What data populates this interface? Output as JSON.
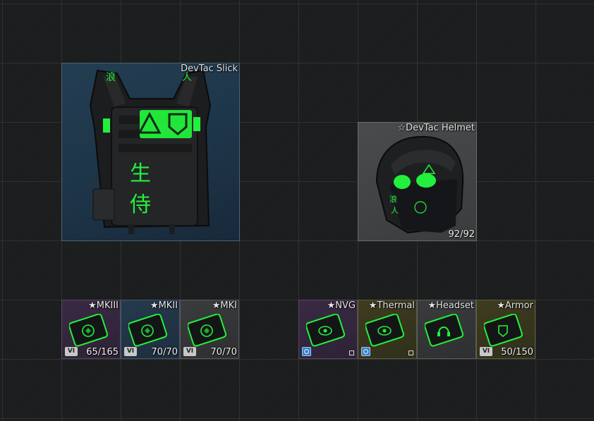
{
  "rig": {
    "name": "DevTac Slick"
  },
  "helmet": {
    "name": "☆DevTac Helmet",
    "durability": "92/92"
  },
  "plates": [
    {
      "name": "★MKIII",
      "badge": "VI",
      "durability": "65/165",
      "color": "purple"
    },
    {
      "name": "★MKII",
      "badge": "VI",
      "durability": "70/70",
      "color": "blue"
    },
    {
      "name": "★MKI",
      "badge": "VI",
      "durability": "70/70",
      "color": "grey"
    }
  ],
  "modules": [
    {
      "name": "★NVG",
      "color": "purple",
      "icon": "eye-icon"
    },
    {
      "name": "★Thermal",
      "color": "olive",
      "icon": "eye-icon"
    },
    {
      "name": "★Headset",
      "color": "grey",
      "icon": "headset-icon"
    },
    {
      "name": "★Armor",
      "badge": "VI",
      "durability": "50/150",
      "color": "olive",
      "icon": "shield-icon"
    }
  ],
  "theme": {
    "accent_green": "#23f03c",
    "grid_line": "#303132"
  }
}
